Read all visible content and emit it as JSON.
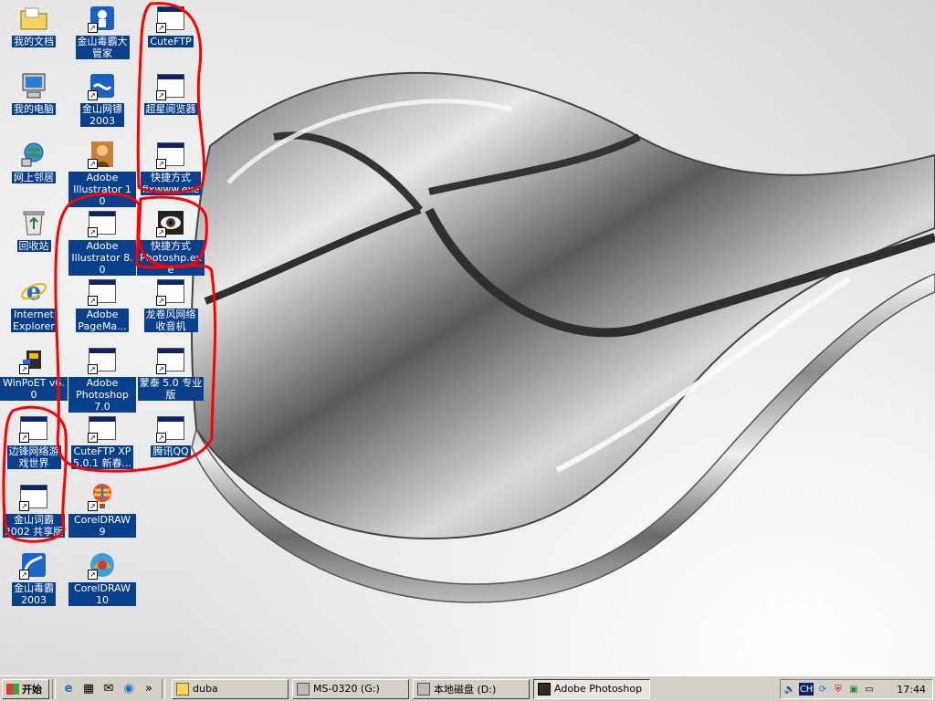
{
  "desktop": {
    "icons": [
      {
        "label": "我的文档",
        "icon": "folder-icon"
      },
      {
        "label": "我的电脑",
        "icon": "computer-icon"
      },
      {
        "label": "网上邻居",
        "icon": "network-icon"
      },
      {
        "label": "回收站",
        "icon": "recycle-bin-icon"
      },
      {
        "label": "Internet\nExplorer",
        "icon": "ie-icon"
      },
      {
        "label": "WinPoET v6.0",
        "icon": "winpoet-icon"
      },
      {
        "label": "边锋网络游\n戏世界",
        "icon": "program-icon"
      },
      {
        "label": "金山词霸\n2002 共享版",
        "icon": "program-icon"
      },
      {
        "label": "金山毒霸\n2003",
        "icon": "duba-icon"
      },
      {
        "label": "金山毒霸大\n管家",
        "icon": "duba-manager-icon"
      },
      {
        "label": "金山网镖\n2003",
        "icon": "netguard-icon"
      },
      {
        "label": "Adobe\nIllustrator 10",
        "icon": "illustrator-icon"
      },
      {
        "label": "Adobe\nIllustrator 8.0",
        "icon": "program-icon"
      },
      {
        "label": "Adobe\nPageMa...",
        "icon": "program-icon"
      },
      {
        "label": "Adobe\nPhotoshop 7.0",
        "icon": "program-icon"
      },
      {
        "label": "CuteFTP XP\n5.0.1 新春...",
        "icon": "program-icon"
      },
      {
        "label": "CorelDRAW 9",
        "icon": "balloon-icon"
      },
      {
        "label": "CorelDRAW 10",
        "icon": "coreldraw-icon"
      },
      {
        "label": "CuteFTP",
        "icon": "program-icon"
      },
      {
        "label": "超星阅览器",
        "icon": "program-icon"
      },
      {
        "label": "快捷方式\nfixwww.exe",
        "icon": "program-icon"
      },
      {
        "label": "快捷方式\nPhotoshp.exe",
        "icon": "eye-icon"
      },
      {
        "label": "龙卷风网络\n收音机",
        "icon": "program-icon"
      },
      {
        "label": "蒙泰 5.0 专业\n版",
        "icon": "program-icon"
      },
      {
        "label": "腾讯QQ",
        "icon": "program-icon"
      }
    ]
  },
  "taskbar": {
    "start_label": "开始",
    "quick_launch": [
      "ie-icon",
      "desktop-icon",
      "outlook-icon",
      "media-icon"
    ],
    "chevron": "»",
    "tasks": [
      {
        "label": "duba",
        "icon": "folder-icon"
      },
      {
        "label": "MS-0320 (G:)",
        "icon": "drive-icon"
      },
      {
        "label": "本地磁盘 (D:)",
        "icon": "drive-icon"
      },
      {
        "label": "Adobe Photoshop",
        "icon": "photoshop-icon"
      }
    ],
    "tray": {
      "language": "CH",
      "icons": [
        "volume-icon",
        "language-icon",
        "network-icon",
        "shield-icon",
        "duba-tray-icon",
        "monitor-icon"
      ],
      "clock": "17:44"
    }
  },
  "colors": {
    "label_bg": "#0a3f8c",
    "annotation": "#ff0000",
    "taskbar": "#d4d0c8"
  }
}
